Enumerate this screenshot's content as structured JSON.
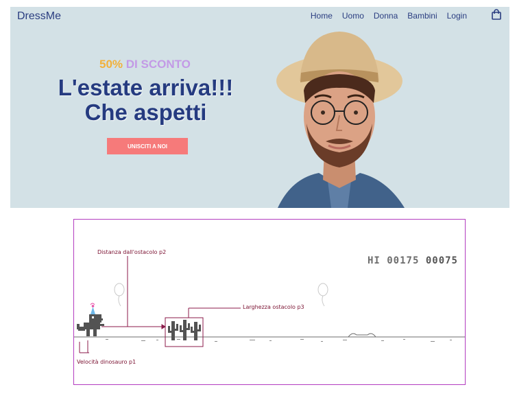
{
  "brand": "DressMe",
  "nav": [
    "Home",
    "Uomo",
    "Donna",
    "Bambini",
    "Login"
  ],
  "hero": {
    "promo_pct": "50%",
    "promo_rest": "DI SCONTO",
    "headline_line1": "L'estate arriva!!!",
    "headline_line2": "Che aspetti",
    "cta": "UNISCITI A NOI"
  },
  "game": {
    "label_distance": "Distanza dall'ostacolo p2",
    "label_width": "Larghezza ostacolo p3",
    "label_speed": "Velocità dinosauro p1",
    "hi_label": "HI",
    "hi_score": "00175",
    "score": "00075"
  },
  "colors": {
    "hero_bg": "#d3e1e6",
    "navy": "#253b80",
    "cta": "#f67a7a",
    "promo_orange": "#f2b13a",
    "promo_purple": "#c39ae6",
    "annotation": "#b33cc0"
  }
}
